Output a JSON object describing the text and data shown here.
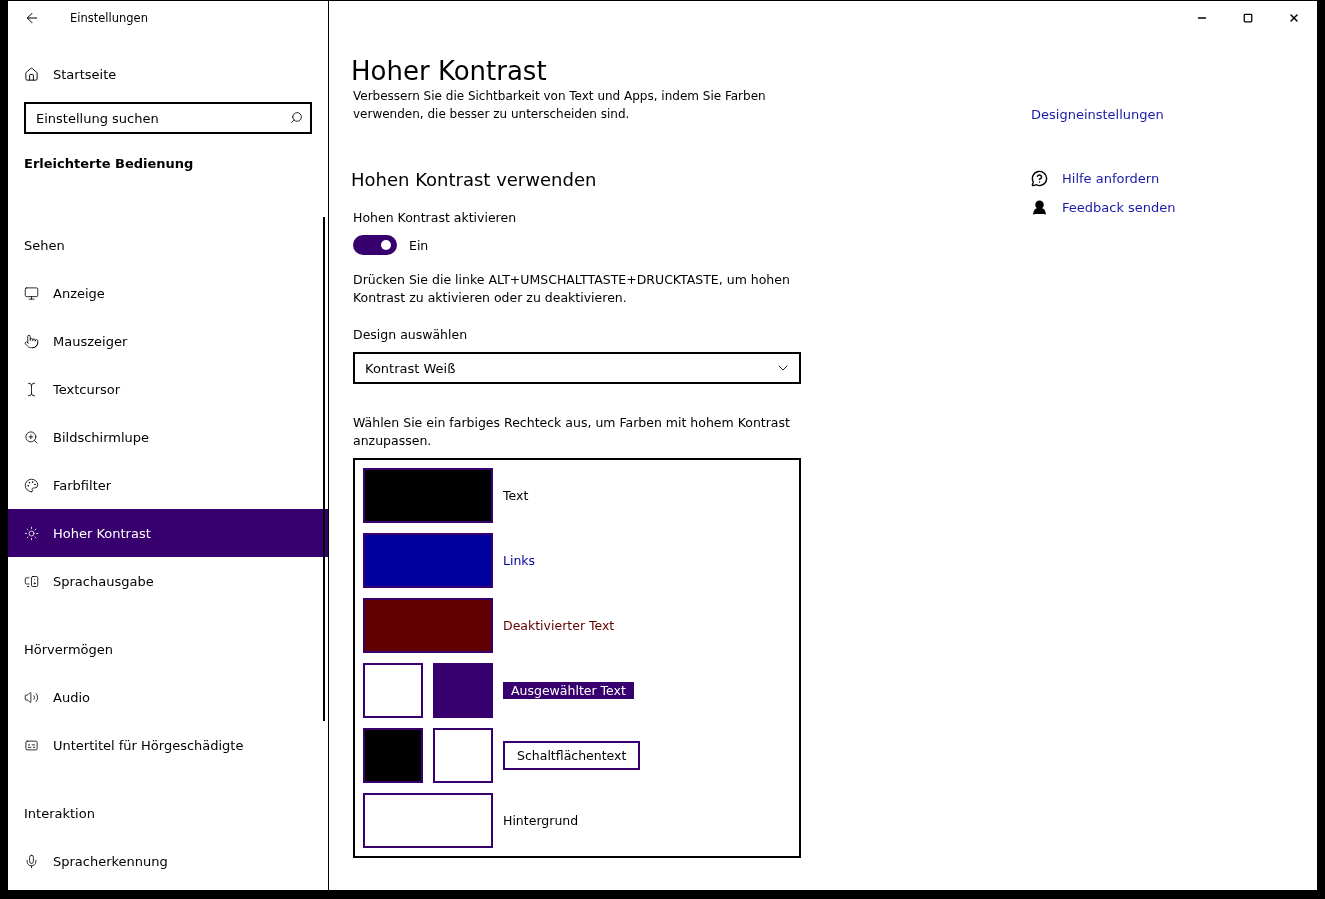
{
  "sidebar": {
    "title": "Einstellungen",
    "home": "Startseite",
    "search": {
      "placeholder": "Einstellung suchen"
    },
    "category": "Erleichterte Bedienung",
    "sections": [
      {
        "heading": "Sehen",
        "items": [
          {
            "label": "Anzeige",
            "selected": false
          },
          {
            "label": "Mauszeiger",
            "selected": false
          },
          {
            "label": "Textcursor",
            "selected": false
          },
          {
            "label": "Bildschirmlupe",
            "selected": false
          },
          {
            "label": "Farbfilter",
            "selected": false
          },
          {
            "label": "Hoher Kontrast",
            "selected": true
          },
          {
            "label": "Sprachausgabe",
            "selected": false
          }
        ]
      },
      {
        "heading": "Hörvermögen",
        "items": [
          {
            "label": "Audio",
            "selected": false
          },
          {
            "label": "Untertitel für Hörgeschädigte",
            "selected": false
          }
        ]
      },
      {
        "heading": "Interaktion",
        "items": [
          {
            "label": "Spracherkennung",
            "selected": false
          }
        ]
      }
    ]
  },
  "main": {
    "title": "Hoher Kontrast",
    "description": "Verbessern Sie die Sichtbarkeit von Text und Apps, indem Sie Farben verwenden, die besser zu unterscheiden sind.",
    "section_heading": "Hohen Kontrast verwenden",
    "toggle": {
      "label": "Hohen Kontrast aktivieren",
      "on": true,
      "state_text": "Ein"
    },
    "hint": "Drücken Sie die linke ALT+UMSCHALTTASTE+DRUCKTASTE, um hohen Kontrast zu aktivieren oder zu deaktivieren.",
    "design": {
      "label": "Design auswählen",
      "value": "Kontrast Weiß"
    },
    "swatch_hint": "Wählen Sie ein farbiges Rechteck aus, um Farben mit hohem Kontrast anzupassen.",
    "swatches": [
      {
        "kind": "plain",
        "label": "Text",
        "swatches": [
          {
            "color": "#000000"
          }
        ]
      },
      {
        "kind": "link",
        "label": "Links",
        "swatches": [
          {
            "color": "#00009f"
          }
        ]
      },
      {
        "kind": "disabled",
        "label": "Deaktivierter Text",
        "swatches": [
          {
            "color": "#600000"
          }
        ]
      },
      {
        "kind": "selected",
        "label": "Ausgewählter Text",
        "swatches": [
          {
            "color": "#ffffff"
          },
          {
            "color": "#37006e"
          }
        ]
      },
      {
        "kind": "button",
        "label": "Schaltflächentext",
        "swatches": [
          {
            "color": "#000000"
          },
          {
            "color": "#ffffff"
          }
        ]
      },
      {
        "kind": "plain",
        "label": "Hintergrund",
        "swatches": [
          {
            "color": "#ffffff"
          }
        ]
      }
    ]
  },
  "aside": {
    "links": [
      {
        "label": "Designeinstellungen",
        "kind": "plain"
      },
      {
        "label": "Hilfe anfordern",
        "kind": "help"
      },
      {
        "label": "Feedback senden",
        "kind": "feedback"
      }
    ]
  }
}
